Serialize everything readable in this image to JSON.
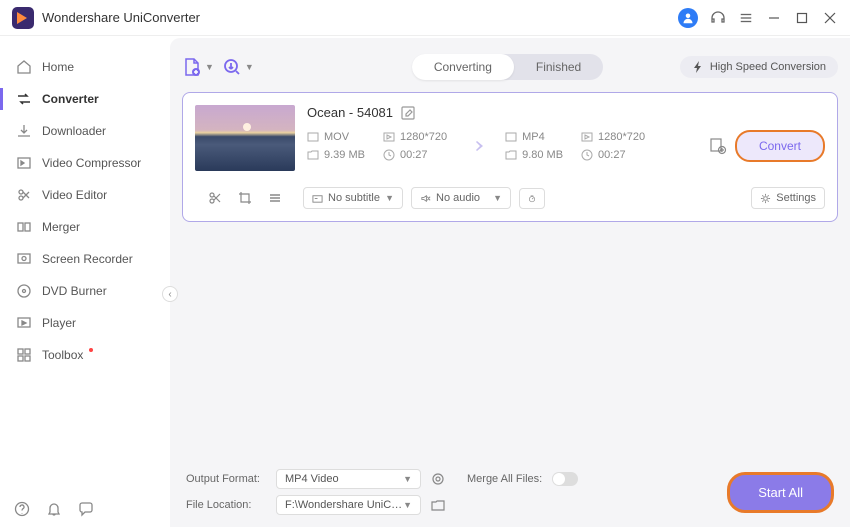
{
  "app": {
    "title": "Wondershare UniConverter"
  },
  "sidebar": {
    "items": [
      {
        "label": "Home"
      },
      {
        "label": "Converter"
      },
      {
        "label": "Downloader"
      },
      {
        "label": "Video Compressor"
      },
      {
        "label": "Video Editor"
      },
      {
        "label": "Merger"
      },
      {
        "label": "Screen Recorder"
      },
      {
        "label": "DVD Burner"
      },
      {
        "label": "Player"
      },
      {
        "label": "Toolbox"
      }
    ]
  },
  "tabs": {
    "converting": "Converting",
    "finished": "Finished"
  },
  "high_speed": "High Speed Conversion",
  "file": {
    "title": "Ocean - 54081",
    "src": {
      "format": "MOV",
      "res": "1280*720",
      "size": "9.39 MB",
      "dur": "00:27"
    },
    "dst": {
      "format": "MP4",
      "res": "1280*720",
      "size": "9.80 MB",
      "dur": "00:27"
    },
    "subtitle": "No subtitle",
    "audio": "No audio",
    "settings": "Settings",
    "convert": "Convert"
  },
  "footer": {
    "output_format_label": "Output Format:",
    "output_format": "MP4 Video",
    "file_location_label": "File Location:",
    "file_location": "F:\\Wondershare UniConverter",
    "merge_label": "Merge All Files:",
    "start_all": "Start All"
  }
}
